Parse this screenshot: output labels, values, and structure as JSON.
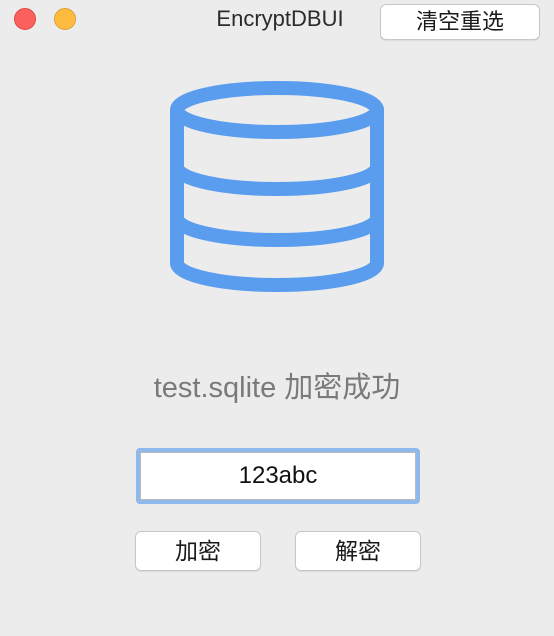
{
  "window": {
    "title": "EncryptDBUI",
    "clear_button_label": "清空重选"
  },
  "main": {
    "icon": "database-icon",
    "icon_color": "#5a9def",
    "status_text": "test.sqlite 加密成功",
    "password_value": "123abc",
    "encrypt_label": "加密",
    "decrypt_label": "解密"
  }
}
